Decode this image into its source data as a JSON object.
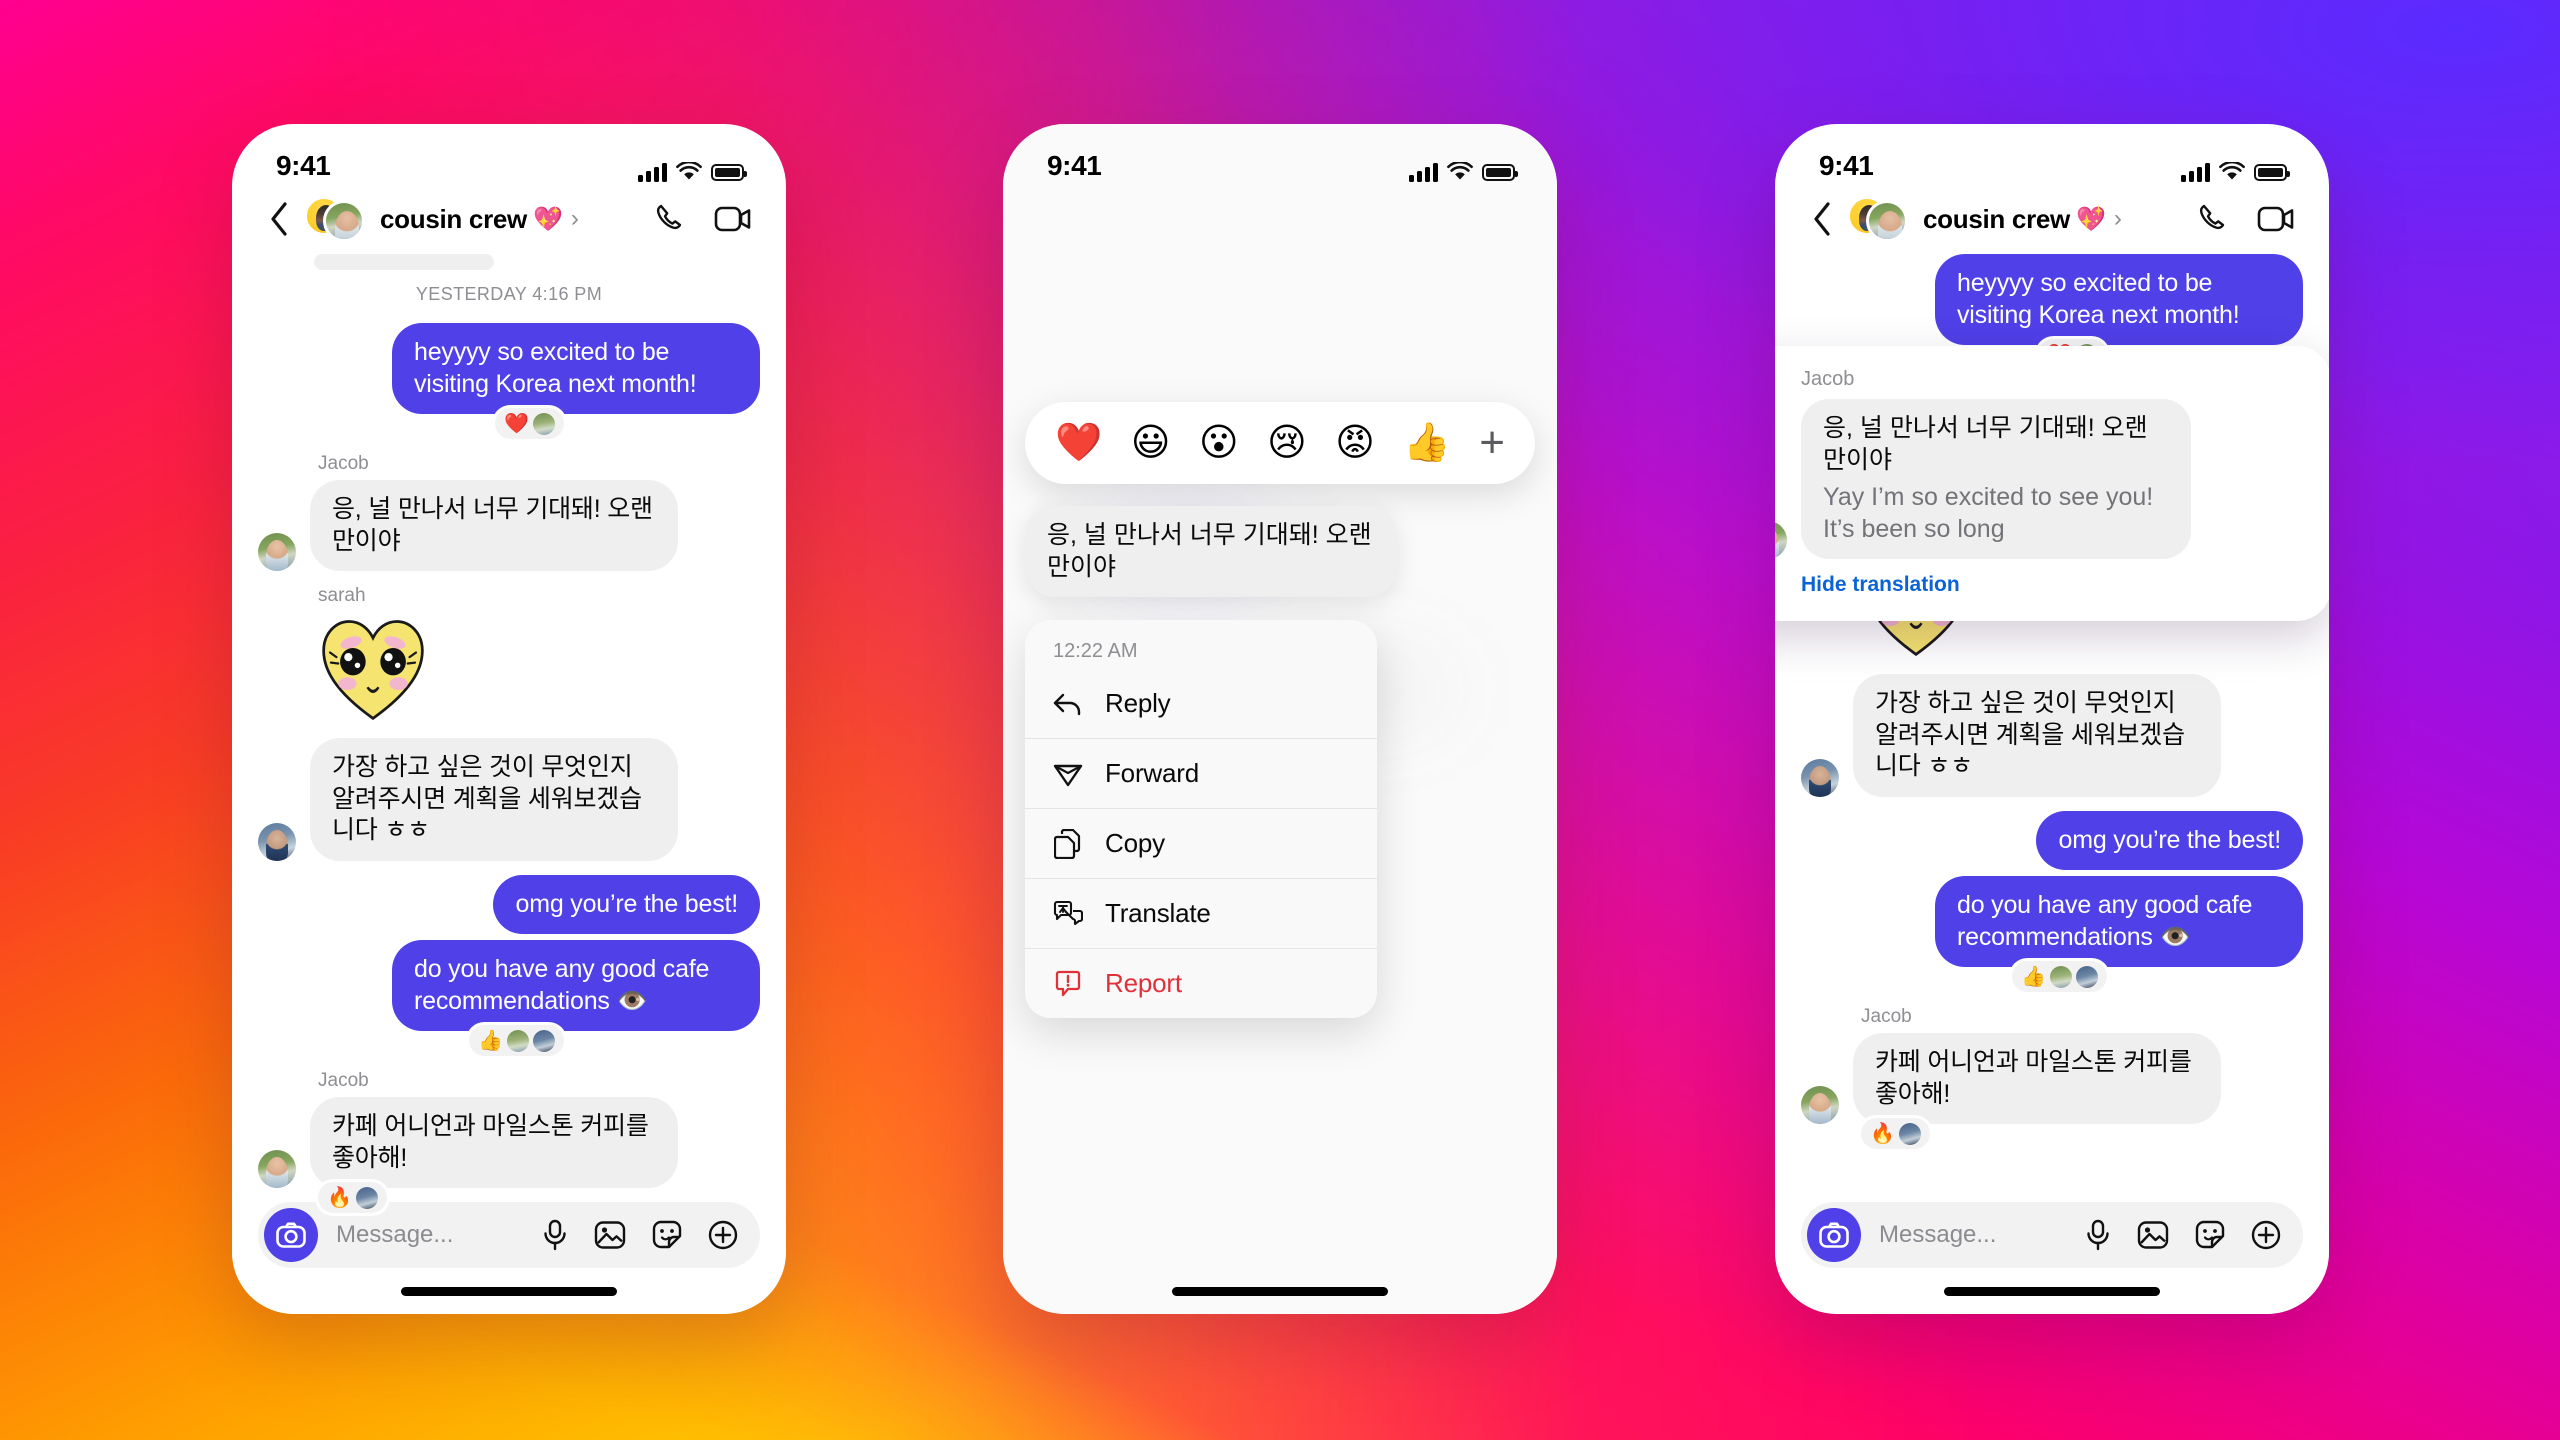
{
  "background": {
    "gradient_colors": [
      "#ff0090",
      "#fa2140",
      "#f93c25",
      "#ffa200",
      "#ffc800",
      "#6a2bff",
      "#b607d6",
      "#ff0066"
    ]
  },
  "colors": {
    "outgoing_bubble": "#4f40e8",
    "incoming_bubble": "#efeff0",
    "accent_link": "#0b63d6",
    "danger": "#e0313a",
    "muted_text": "#8e8e93"
  },
  "status_bar": {
    "time": "9:41",
    "signal_icon": "cellular-signal-icon",
    "wifi_icon": "wifi-icon",
    "battery_icon": "battery-full-icon"
  },
  "header": {
    "back_icon": "back-chevron-icon",
    "avatar_icon": "group-avatar",
    "title": "cousin crew",
    "title_emoji": "💖",
    "chevron": "›",
    "call_icon": "phone-call-icon",
    "video_icon": "video-camera-icon"
  },
  "composer": {
    "camera_icon": "camera-icon",
    "placeholder": "Message...",
    "mic_icon": "microphone-icon",
    "photo_icon": "photo-gallery-icon",
    "sticker_icon": "sticker-icon",
    "plus_icon": "plus-circle-icon"
  },
  "phone1": {
    "daystamp": "YESTERDAY 4:16 PM",
    "messages": [
      {
        "id": "m1",
        "direction": "out",
        "text": "heyyyy so excited to be visiting Korea next month!",
        "reactions": [
          "❤️"
        ],
        "reaction_avatars": 1
      },
      {
        "id": "m2",
        "direction": "in",
        "sender": "Jacob",
        "text": "응, 널 만나서 너무 기대돼! 오랜만이야"
      },
      {
        "id": "m3",
        "direction": "in",
        "sender": "sarah",
        "type": "sticker",
        "sticker_name": "yellow-heart-face-sticker"
      },
      {
        "id": "m4",
        "direction": "in",
        "text": "가장 하고 싶은 것이 무엇인지 알려주시면 계획을 세워보겠습니다 ㅎㅎ"
      },
      {
        "id": "m5",
        "direction": "out",
        "text": "omg you’re the best!"
      },
      {
        "id": "m6",
        "direction": "out",
        "text": "do you have any good cafe recommendations 👁️",
        "reactions": [
          "👍"
        ],
        "reaction_avatars": 2
      },
      {
        "id": "m7",
        "direction": "in",
        "sender": "Jacob",
        "text": "카페 어니언과 마일스톤 커피를 좋아해!",
        "reactions": [
          "🔥"
        ],
        "reaction_avatars": 1
      }
    ]
  },
  "phone2": {
    "reaction_bar": {
      "emojis": [
        "❤️",
        "😃",
        "😮",
        "😢",
        "😡",
        "👍"
      ],
      "add_label": "+",
      "add_icon": "plus-icon"
    },
    "focused_message": "응, 널 만나서 너무 기대돼! 오랜만이야",
    "context_menu": {
      "timestamp": "12:22 AM",
      "items": [
        {
          "label": "Reply",
          "icon": "reply-arrow-icon",
          "danger": false
        },
        {
          "label": "Forward",
          "icon": "forward-send-icon",
          "danger": false
        },
        {
          "label": "Copy",
          "icon": "copy-pages-icon",
          "danger": false
        },
        {
          "label": "Translate",
          "icon": "translate-icon",
          "danger": false
        },
        {
          "label": "Report",
          "icon": "report-warning-icon",
          "danger": true
        }
      ]
    }
  },
  "phone3": {
    "top_message": {
      "direction": "out",
      "text": "heyyyy so excited to be visiting Korea next month!",
      "reactions": [
        "❤️"
      ]
    },
    "translation_card": {
      "sender": "Jacob",
      "original": "응, 널 만나서 너무 기대돼! 오랜만이야",
      "translation": "Yay I’m so excited to see you! It’s been so long",
      "hide_label": "Hide translation"
    },
    "messages": [
      {
        "id": "p3m1",
        "direction": "in",
        "type": "sticker",
        "sticker_name": "yellow-heart-face-sticker"
      },
      {
        "id": "p3m2",
        "direction": "in",
        "text": "가장 하고 싶은 것이 무엇인지 알려주시면 계획을 세워보겠습니다 ㅎㅎ"
      },
      {
        "id": "p3m3",
        "direction": "out",
        "text": "omg you’re the best!"
      },
      {
        "id": "p3m4",
        "direction": "out",
        "text": "do you have any good cafe recommendations 👁️",
        "reactions": [
          "👍"
        ],
        "reaction_avatars": 2
      },
      {
        "id": "p3m5",
        "direction": "in",
        "sender": "Jacob",
        "text": "카페 어니언과 마일스톤 커피를 좋아해!",
        "reactions": [
          "🔥"
        ],
        "reaction_avatars": 1
      }
    ]
  }
}
